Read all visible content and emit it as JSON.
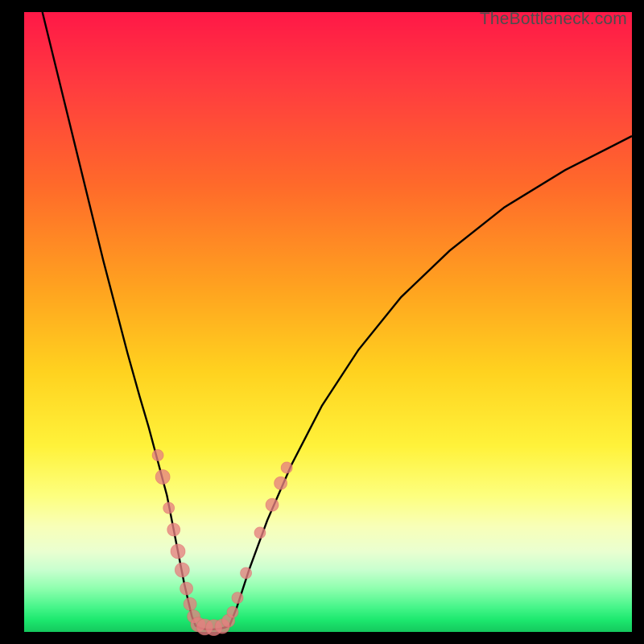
{
  "watermark": "TheBottleneck.com",
  "colors": {
    "curve": "#000000",
    "dot_fill": "#e68080",
    "bg_top": "#ff1847",
    "bg_bottom": "#14c85d"
  },
  "chart_data": {
    "type": "line",
    "title": "",
    "xlabel": "",
    "ylabel": "",
    "xlim": [
      0,
      100
    ],
    "ylim": [
      0,
      100
    ],
    "series": [
      {
        "name": "left-curve",
        "x": [
          3,
          5,
          7,
          9,
          11,
          13,
          15,
          17,
          19,
          20.5,
          22,
          23.5,
          24.5,
          25.5,
          26.3,
          27,
          27.6,
          28.2
        ],
        "y": [
          100,
          92,
          84,
          76,
          68,
          60,
          52.5,
          45,
          38,
          33,
          27.5,
          22,
          17,
          12,
          8,
          5,
          2.5,
          1
        ]
      },
      {
        "name": "valley-floor",
        "x": [
          28.2,
          29,
          30,
          31,
          32,
          33,
          33.8
        ],
        "y": [
          1,
          0.6,
          0.4,
          0.4,
          0.5,
          0.7,
          1
        ]
      },
      {
        "name": "right-curve",
        "x": [
          33.8,
          35,
          37,
          40,
          44,
          49,
          55,
          62,
          70,
          79,
          89,
          100
        ],
        "y": [
          1,
          4,
          10,
          18,
          27,
          36.5,
          45.5,
          54,
          61.5,
          68.5,
          74.5,
          80
        ]
      }
    ],
    "scatter": {
      "name": "dots",
      "points": [
        {
          "x": 22.0,
          "y": 28.5,
          "r": 7
        },
        {
          "x": 22.8,
          "y": 25.0,
          "r": 9
        },
        {
          "x": 23.8,
          "y": 20.0,
          "r": 7
        },
        {
          "x": 24.6,
          "y": 16.5,
          "r": 8
        },
        {
          "x": 25.3,
          "y": 13.0,
          "r": 9
        },
        {
          "x": 26.0,
          "y": 10.0,
          "r": 9
        },
        {
          "x": 26.7,
          "y": 7.0,
          "r": 8
        },
        {
          "x": 27.3,
          "y": 4.5,
          "r": 8
        },
        {
          "x": 27.9,
          "y": 2.5,
          "r": 8
        },
        {
          "x": 28.6,
          "y": 1.2,
          "r": 9
        },
        {
          "x": 29.7,
          "y": 0.8,
          "r": 10
        },
        {
          "x": 31.2,
          "y": 0.7,
          "r": 10
        },
        {
          "x": 32.6,
          "y": 0.9,
          "r": 9
        },
        {
          "x": 33.6,
          "y": 1.8,
          "r": 8
        },
        {
          "x": 34.3,
          "y": 3.2,
          "r": 7
        },
        {
          "x": 35.1,
          "y": 5.5,
          "r": 7
        },
        {
          "x": 36.5,
          "y": 9.5,
          "r": 7
        },
        {
          "x": 38.8,
          "y": 16.0,
          "r": 7
        },
        {
          "x": 40.8,
          "y": 20.5,
          "r": 8
        },
        {
          "x": 42.2,
          "y": 24.0,
          "r": 8
        },
        {
          "x": 43.2,
          "y": 26.5,
          "r": 7
        }
      ]
    }
  }
}
